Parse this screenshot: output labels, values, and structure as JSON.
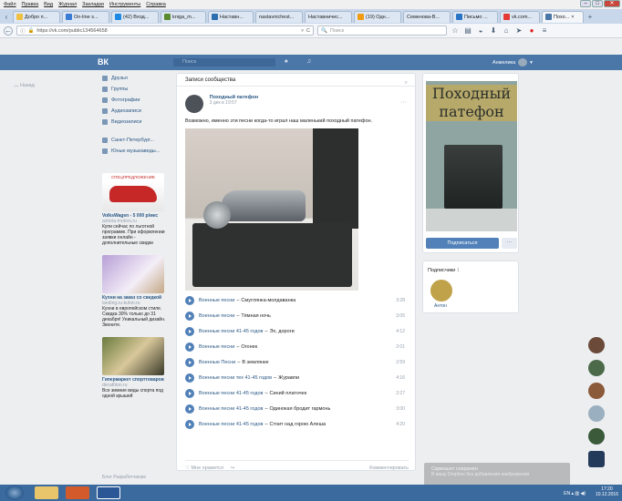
{
  "browser": {
    "menu": [
      "Файл",
      "Правка",
      "Вид",
      "Журнал",
      "Закладки",
      "Инструменты",
      "Справка"
    ],
    "tabs": [
      {
        "label": "Добро п...",
        "color": "#f0c040"
      },
      {
        "label": "On-line s...",
        "color": "#3a7bd5"
      },
      {
        "label": "(42) Вход...",
        "color": "#1e88e5"
      },
      {
        "label": "kniga_m...",
        "color": "#5a8c2f"
      },
      {
        "label": "Наставн...",
        "color": "#2f6fb0"
      },
      {
        "label": "nastavnichest...",
        "color": "#cccccc"
      },
      {
        "label": "Наставничес...",
        "color": "#cccccc"
      },
      {
        "label": "(19) Одн...",
        "color": "#f39c12"
      },
      {
        "label": "Семенова-В...",
        "color": "#cccccc"
      },
      {
        "label": "Письмо ...",
        "color": "#2a74c5"
      },
      {
        "label": "vk.com...",
        "color": "#e53935"
      },
      {
        "label": "Похо...",
        "color": "#4a76a8"
      }
    ],
    "url": "https://vk.com/public134564658",
    "search_placeholder": "Поиск",
    "new_tab": "+"
  },
  "vk": {
    "logo": "ВК",
    "search_placeholder": "Поиск",
    "user_name": "Анжелика",
    "back_label": "Назад",
    "sidebar": [
      {
        "label": "Друзья"
      },
      {
        "label": "Группы"
      },
      {
        "label": "Фотографии"
      },
      {
        "label": "Аудиозаписи"
      },
      {
        "label": "Видеозаписи"
      }
    ],
    "sidebar_groups": [
      {
        "label": "Санкт-Петербург..."
      },
      {
        "label": "Юные музыкаведы..."
      }
    ],
    "ads": [
      {
        "badge": "СПЕЦПРЕДЛОЖЕНИЕ",
        "title": "VolksWagen - 5 000 р/мес",
        "site": "avtoria-motors.ru",
        "text": "Купи сейчас по льготной программе. При оформлении заявки онлайн - дополнительные скидки",
        "color": "#c62828"
      },
      {
        "title": "Кухни на заказ со скидкой",
        "site": "landing.ru-kuhni.ru",
        "text": "Кухни в европейском стиле. Скидка 30% только до 31 декабря! Уникальный дизайн. Звоните.",
        "color": "#8e6fb3"
      },
      {
        "title": "Гипермаркет спорттоваров",
        "site": "decathlon.ru",
        "text": "Все зимние виды спорта под одной крышей",
        "color": "#6a7b3e"
      }
    ],
    "footer": "Блог  Разработчикам",
    "feed": {
      "heading": "Записи сообщества",
      "post": {
        "author": "Походный патефон",
        "date": "3 дек в 19:57",
        "text": "Возможно, именно эти песни когда-то играл наш маленький походный патефон.",
        "tracks": [
          {
            "artist": "Военные песни",
            "title": "Смуглянка-молдаванка",
            "duration": "3:28"
          },
          {
            "artist": "Военные песни",
            "title": "Тёмная ночь",
            "duration": "3:05"
          },
          {
            "artist": "Военные песни 41-45 годов",
            "title": "Эх, дороги",
            "duration": "4:12"
          },
          {
            "artist": "Военные песни",
            "title": "Огонек",
            "duration": "2:01"
          },
          {
            "artist": "Военные Песни",
            "title": "В землянке",
            "duration": "2:59"
          },
          {
            "artist": "Военные песни тех 41-45 годов",
            "title": "Журавли",
            "duration": "4:16"
          },
          {
            "artist": "Военные песни 41-45 годов",
            "title": "Синий платочек",
            "duration": "2:27"
          },
          {
            "artist": "Военные песни 41-45 годов",
            "title": "Одинокая бродит гармонь",
            "duration": "3:00"
          },
          {
            "artist": "Военные песни 41-45 годов",
            "title": "Стоит над горою Алеша",
            "duration": "4:20"
          }
        ],
        "like_label": "Мне нравится",
        "comment_label": "Комментировать"
      }
    },
    "group": {
      "cover_title": "Походный патефон",
      "subscribe_label": "Подписаться",
      "more_label": "···",
      "subscribers_label": "Подписчики",
      "subscribers_count": "1",
      "subscriber_name": "Антон"
    },
    "save_popup": {
      "title": "Скриншот сохранен",
      "text": "В вашу Dropbox без добавления изображения"
    }
  },
  "taskbar": {
    "lang": "EN",
    "time": "17:20",
    "date": "10.12.2016"
  }
}
